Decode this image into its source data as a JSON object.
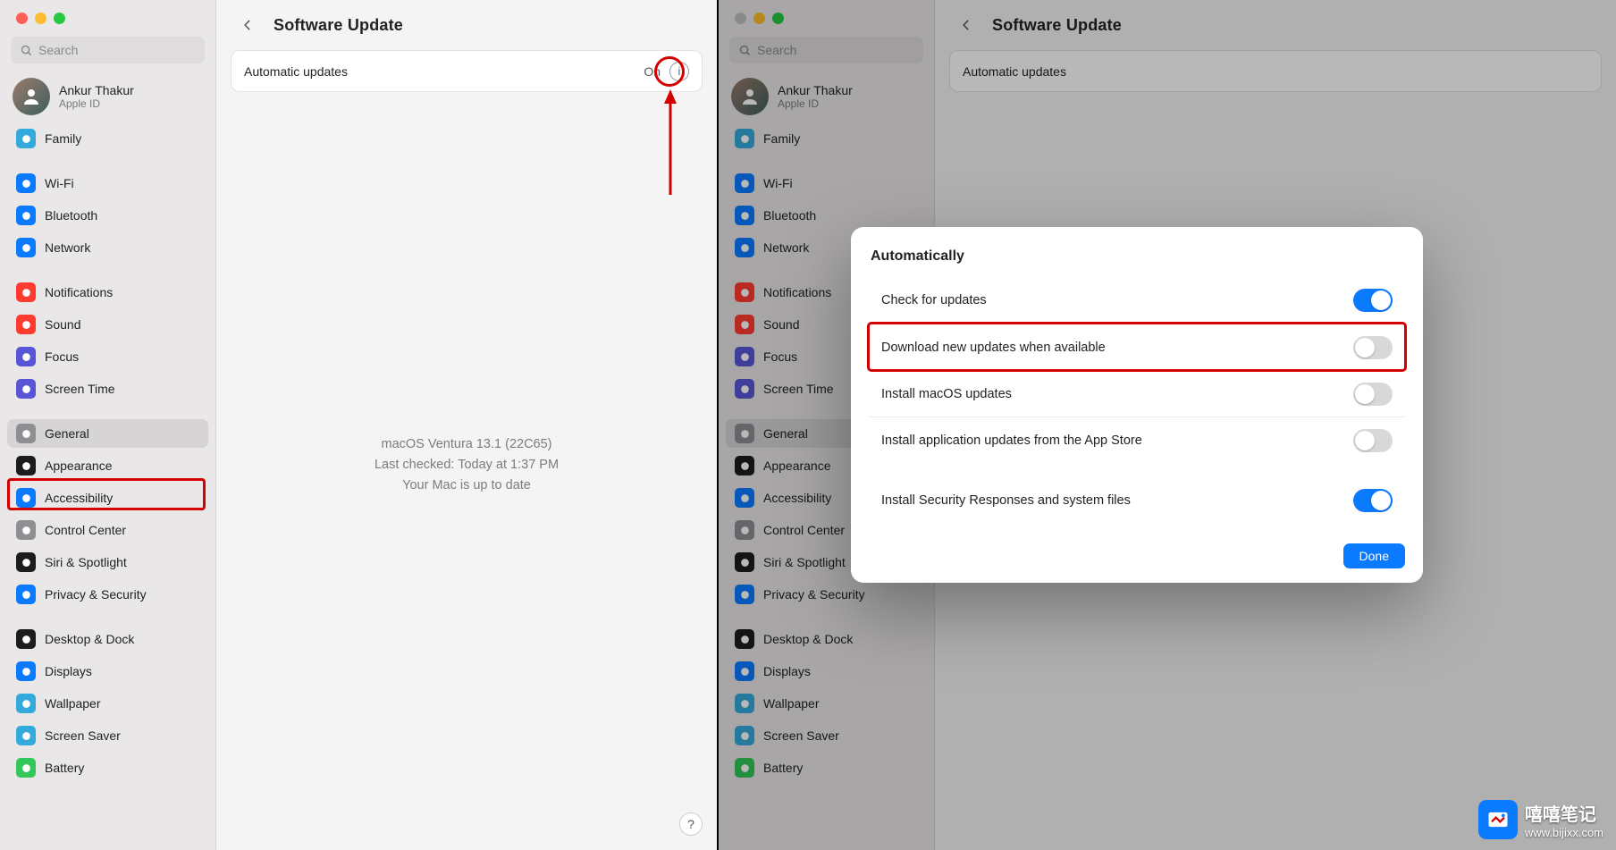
{
  "profile": {
    "name": "Ankur Thakur",
    "sub": "Apple ID"
  },
  "search": {
    "placeholder": "Search"
  },
  "header": {
    "title": "Software Update"
  },
  "auto_row": {
    "label": "Automatic updates",
    "value": "On"
  },
  "status": {
    "line1": "macOS Ventura 13.1 (22C65)",
    "line2": "Last checked: Today at 1:37 PM",
    "line3": "Your Mac is up to date"
  },
  "sidebar": {
    "items": [
      {
        "label": "Family",
        "icon_name": "family-icon",
        "color": "bg-teal"
      },
      {
        "label": "Wi-Fi",
        "icon_name": "wifi-icon",
        "color": "bg-blue"
      },
      {
        "label": "Bluetooth",
        "icon_name": "bluetooth-icon",
        "color": "bg-blue"
      },
      {
        "label": "Network",
        "icon_name": "network-icon",
        "color": "bg-blue"
      },
      {
        "label": "Notifications",
        "icon_name": "notifications-icon",
        "color": "bg-red"
      },
      {
        "label": "Sound",
        "icon_name": "sound-icon",
        "color": "bg-red"
      },
      {
        "label": "Focus",
        "icon_name": "focus-icon",
        "color": "bg-purple"
      },
      {
        "label": "Screen Time",
        "icon_name": "screentime-icon",
        "color": "bg-purple"
      },
      {
        "label": "General",
        "icon_name": "gear-icon",
        "color": "bg-gray",
        "selected": true
      },
      {
        "label": "Appearance",
        "icon_name": "appearance-icon",
        "color": "bg-black"
      },
      {
        "label": "Accessibility",
        "icon_name": "accessibility-icon",
        "color": "bg-blue"
      },
      {
        "label": "Control Center",
        "icon_name": "controlcenter-icon",
        "color": "bg-gray"
      },
      {
        "label": "Siri & Spotlight",
        "icon_name": "siri-icon",
        "color": "bg-black"
      },
      {
        "label": "Privacy & Security",
        "icon_name": "privacy-icon",
        "color": "bg-blue"
      },
      {
        "label": "Desktop & Dock",
        "icon_name": "desktop-icon",
        "color": "bg-black"
      },
      {
        "label": "Displays",
        "icon_name": "displays-icon",
        "color": "bg-blue"
      },
      {
        "label": "Wallpaper",
        "icon_name": "wallpaper-icon",
        "color": "bg-teal"
      },
      {
        "label": "Screen Saver",
        "icon_name": "screensaver-icon",
        "color": "bg-teal"
      },
      {
        "label": "Battery",
        "icon_name": "battery-icon",
        "color": "bg-green"
      }
    ],
    "spacers_after": [
      0,
      3,
      7,
      13
    ]
  },
  "dialog": {
    "title": "Automatically",
    "rows": [
      {
        "label": "Check for updates",
        "on": true
      },
      {
        "label": "Download new updates when available",
        "on": false,
        "highlight": true
      },
      {
        "label": "Install macOS updates",
        "on": false
      },
      {
        "label": "Install application updates from the App Store",
        "on": false
      },
      {
        "label": "Install Security Responses and system files",
        "on": true,
        "separate": true
      }
    ],
    "done": "Done"
  },
  "help_glyph": "?",
  "info_glyph": "i",
  "watermark": {
    "t1": "嘻嘻笔记",
    "t2": "www.bijixx.com"
  }
}
